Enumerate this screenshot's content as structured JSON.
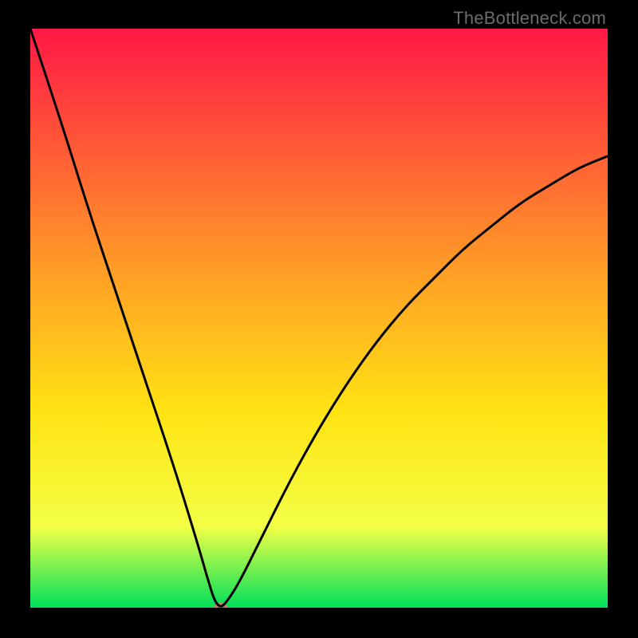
{
  "watermark": {
    "text": "TheBottleneck.com"
  },
  "chart_data": {
    "type": "line",
    "title": "",
    "xlabel": "",
    "ylabel": "",
    "xlim": [
      0,
      100
    ],
    "ylim": [
      0,
      100
    ],
    "grid": false,
    "legend": false,
    "background_gradient": {
      "top": "#ff1846",
      "mid_upper": "#ff9e26",
      "mid": "#ffe313",
      "mid_lower": "#f3ff45",
      "bottom": "#00e05a"
    },
    "series": [
      {
        "name": "curve",
        "x": [
          0,
          5,
          10,
          15,
          20,
          25,
          29,
          31,
          32,
          33,
          34,
          36,
          40,
          45,
          50,
          55,
          60,
          65,
          70,
          75,
          80,
          85,
          90,
          95,
          100
        ],
        "values": [
          100,
          85,
          69,
          54,
          39,
          24,
          11,
          4,
          1,
          0,
          1,
          4,
          12,
          22,
          31,
          39,
          46,
          52,
          57,
          62,
          66,
          70,
          73,
          76,
          78
        ]
      }
    ],
    "marker": {
      "x": 33,
      "y": 0,
      "color": "#cf7a66",
      "rx": 9,
      "ry": 6
    },
    "line_color": "#000000",
    "line_width": 3
  }
}
